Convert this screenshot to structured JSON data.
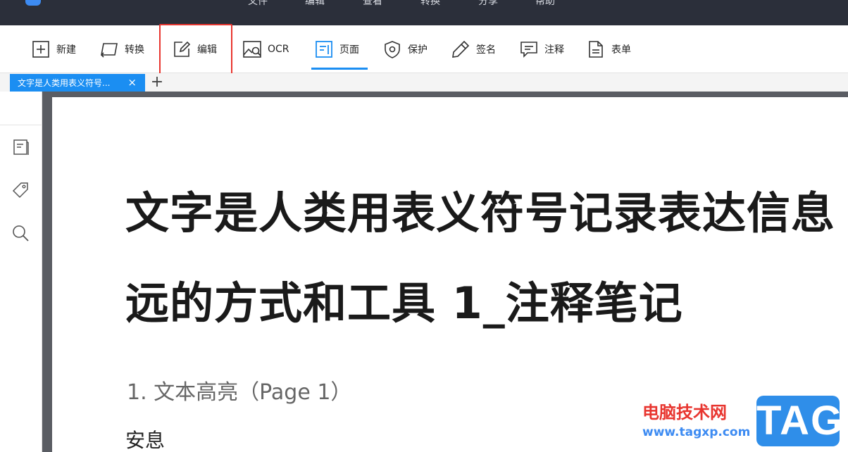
{
  "menubar": {
    "items": [
      "文件",
      "编辑",
      "查看",
      "转换",
      "分享",
      "帮助"
    ]
  },
  "toolbar": {
    "tools": [
      {
        "key": "new",
        "label": "新建",
        "icon": "plus-box-icon"
      },
      {
        "key": "convert",
        "label": "转换",
        "icon": "convert-icon"
      },
      {
        "key": "edit",
        "label": "编辑",
        "icon": "edit-pen-icon"
      },
      {
        "key": "ocr",
        "label": "OCR",
        "icon": "ocr-image-search-icon"
      },
      {
        "key": "page",
        "label": "页面",
        "icon": "page-icon"
      },
      {
        "key": "protect",
        "label": "保护",
        "icon": "shield-icon"
      },
      {
        "key": "sign",
        "label": "签名",
        "icon": "pen-icon"
      },
      {
        "key": "annotate",
        "label": "注释",
        "icon": "comment-icon"
      },
      {
        "key": "form",
        "label": "表单",
        "icon": "form-doc-icon"
      }
    ],
    "active": "页面",
    "highlight_color": "#e8352f",
    "accent_color": "#1b8ef2"
  },
  "tabs": {
    "doc_title": "文字是人类用表义符号...",
    "close": "×",
    "add": "+"
  },
  "sidebar": {
    "icons": [
      "bookmark-list-icon",
      "tag-icon",
      "search-icon"
    ]
  },
  "document": {
    "title_line1": "文字是人类用表义符号记录表达信息",
    "title_line2": "远的方式和工具 1_注释笔记",
    "subtitle": "1. 文本高亮（Page 1）",
    "body": "安息"
  },
  "watermark": {
    "site_name": "电脑技术网",
    "url": "www.tagxp.com",
    "logo_text": "TAG"
  }
}
